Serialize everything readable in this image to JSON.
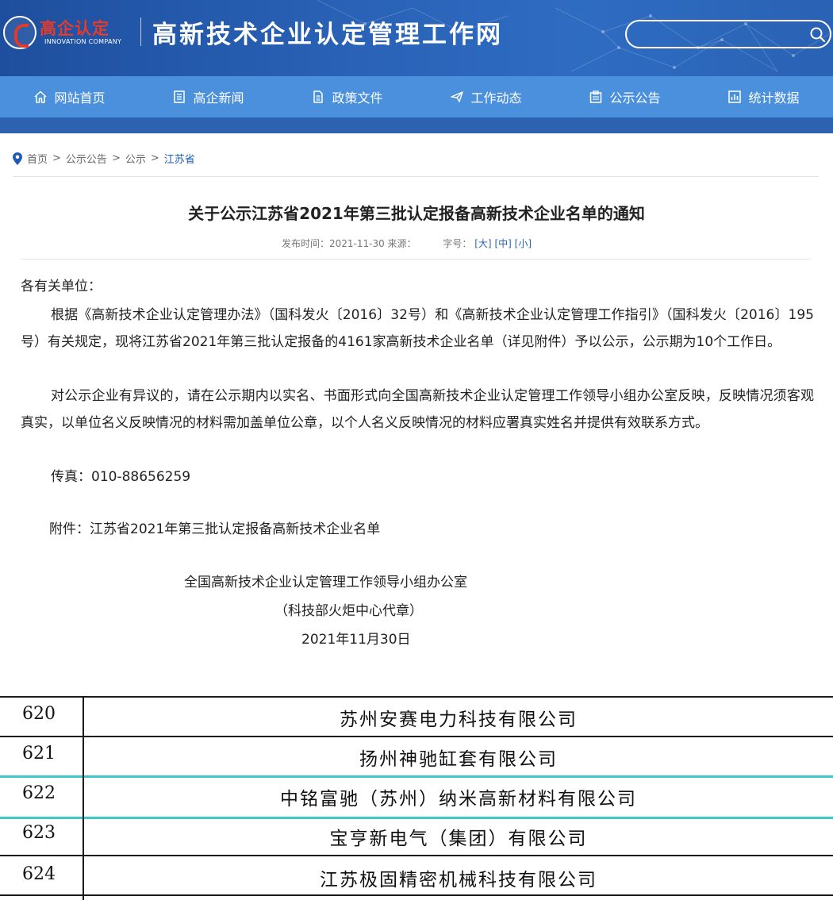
{
  "header": {
    "logo_text": "高企认定",
    "logo_sub": "INNOVATION COMPANY",
    "site_title": "高新技术企业认定管理工作网",
    "search_placeholder": ""
  },
  "nav": {
    "items": [
      {
        "label": "网站首页",
        "icon": "home-icon"
      },
      {
        "label": "高企新闻",
        "icon": "news-icon"
      },
      {
        "label": "政策文件",
        "icon": "document-icon"
      },
      {
        "label": "工作动态",
        "icon": "send-icon"
      },
      {
        "label": "公示公告",
        "icon": "clipboard-icon"
      },
      {
        "label": "统计数据",
        "icon": "chart-icon"
      }
    ]
  },
  "breadcrumb": {
    "items": [
      "首页",
      "公示公告",
      "公示",
      "江苏省"
    ],
    "separator": ">"
  },
  "article": {
    "title": "关于公示江苏省2021年第三批认定报备高新技术企业名单的通知",
    "meta_published": "发布时间：2021-11-30 来源：",
    "meta_fontsize_label": "字号：",
    "font_sizes": [
      "[大]",
      "[中]",
      "[小]"
    ],
    "salutation": "各有关单位：",
    "para1": "根据《高新技术企业认定管理办法》（国科发火〔2016〕32号）和《高新技术企业认定管理工作指引》（国科发火〔2016〕195号）有关规定，现将江苏省2021年第三批认定报备的4161家高新技术企业名单（详见附件）予以公示，公示期为10个工作日。",
    "para2": "对公示企业有异议的，请在公示期内以实名、书面形式向全国高新技术企业认定管理工作领导小组办公室反映，反映情况须客观真实，以单位名义反映情况的材料需加盖单位公章，以个人名义反映情况的材料应署真实姓名并提供有效联系方式。",
    "fax": "传真：010-88656259",
    "attachment": "附件：江苏省2021年第三批认定报备高新技术企业名单",
    "signature_org": "全国高新技术企业认定管理工作领导小组办公室",
    "signature_seal": "（科技部火炬中心代章）",
    "signature_date": "2021年11月30日"
  },
  "table": {
    "rows": [
      {
        "no": "620",
        "name": "苏州安赛电力科技有限公司"
      },
      {
        "no": "621",
        "name": "扬州神驰缸套有限公司"
      },
      {
        "no": "622",
        "name": "中铭富驰（苏州）纳米高新材料有限公司"
      },
      {
        "no": "623",
        "name": "宝亨新电气（集团）有限公司"
      },
      {
        "no": "624",
        "name": "江苏极固精密机械科技有限公司"
      }
    ],
    "highlight_color": "#3ec8c8"
  },
  "colors": {
    "header_bg": "#2a63b8",
    "nav_bg": "#4a90dc",
    "subbar_bg": "#2d62b1",
    "logo_red": "#e63b2c",
    "link_blue": "#1d5cb5"
  }
}
